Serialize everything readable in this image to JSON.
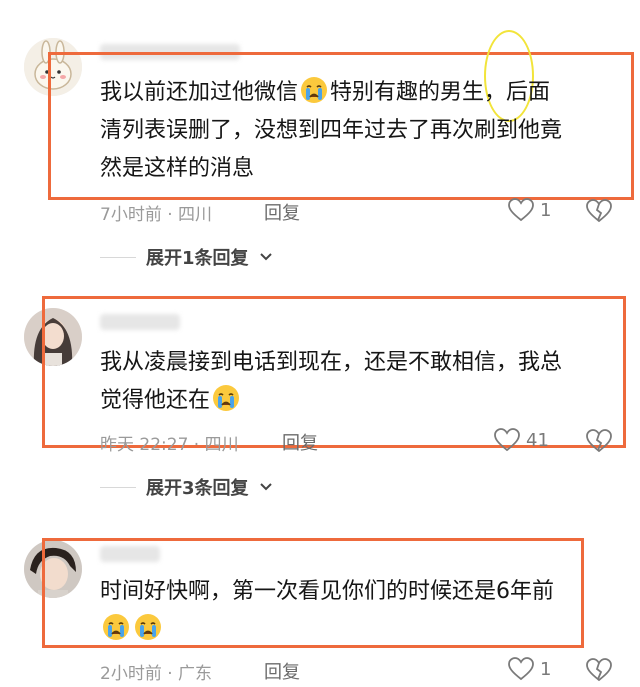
{
  "comments": [
    {
      "text_line1": "我以前还加过他微信",
      "text_line1b": "特别有趣的男生，后面",
      "text_line2": "清列表误删了，没想到四年过去了再次刷到他竟",
      "text_line3": "然是这样的消息",
      "meta": "7小时前 · 四川",
      "reply_label": "回复",
      "likes": "1",
      "expand_label": "展开1条回复"
    },
    {
      "text_line1": "我从凌晨接到电话到现在，还是不敢相信，我总",
      "text_line2": "觉得他还在",
      "meta": "昨天 22:27 · 四川",
      "reply_label": "回复",
      "likes": "41",
      "expand_label": "展开3条回复"
    },
    {
      "text_line1": "时间好快啊，第一次看见你们的时候还是6年前",
      "meta": "2小时前 · 广东",
      "reply_label": "回复",
      "likes": "1"
    }
  ],
  "icons": {
    "emoji": "crying-face-icon",
    "like": "heart-outline-icon",
    "dislike": "broken-heart-icon",
    "expand": "chevron-down-icon"
  },
  "colors": {
    "highlight_frame": "#ee6a3c",
    "highlight_circle": "#f2e43a",
    "meta_text": "#9a9a9a"
  }
}
